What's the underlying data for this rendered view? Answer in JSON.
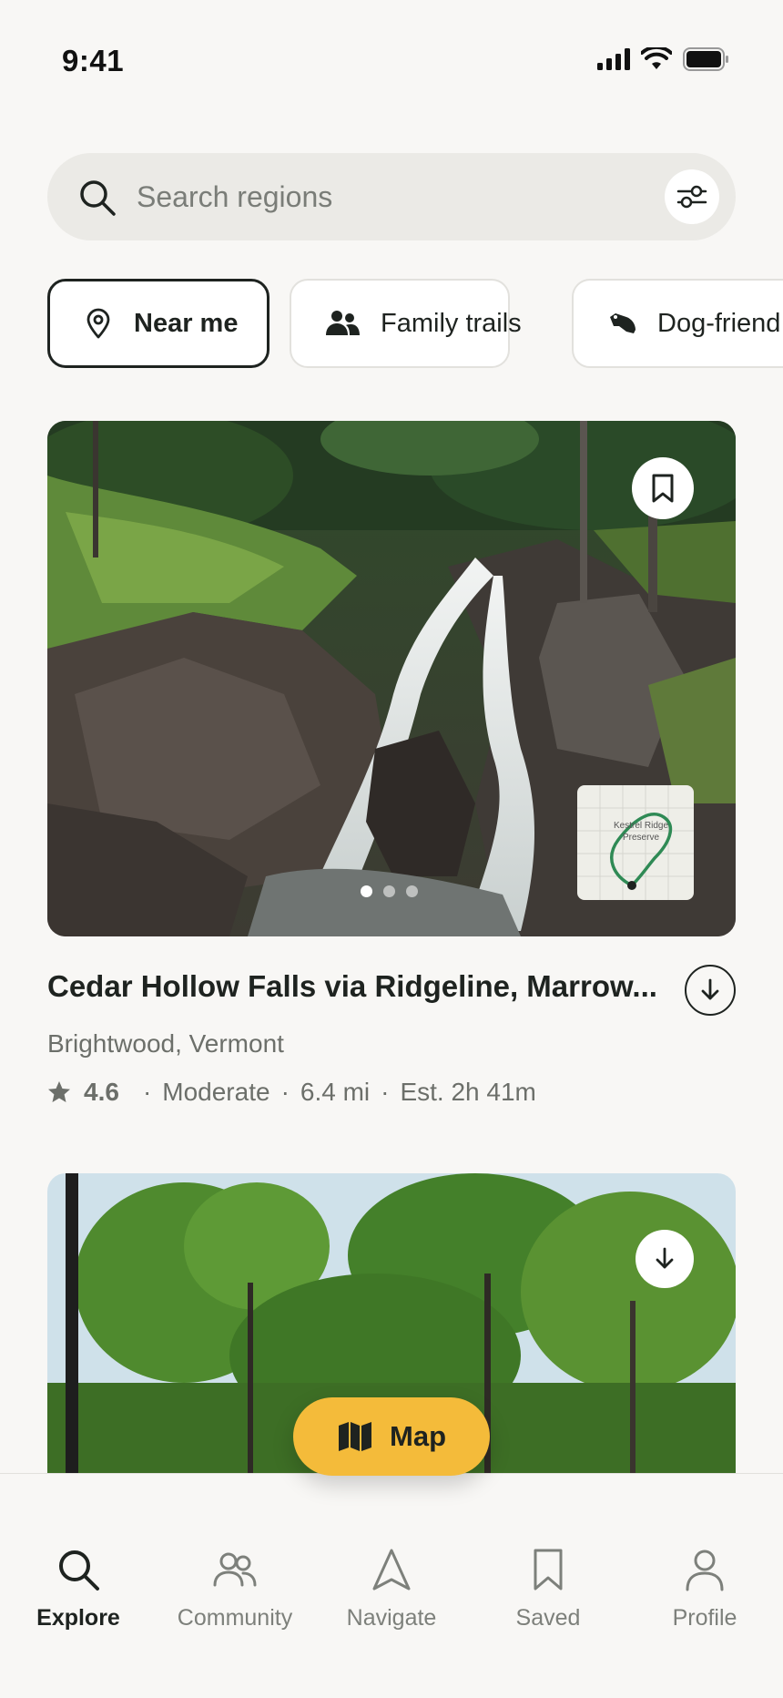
{
  "status_bar": {
    "time": "9:41"
  },
  "search": {
    "placeholder": "Search regions"
  },
  "chips": [
    {
      "label": "Near me",
      "icon": "location-pin-icon",
      "active": true
    },
    {
      "label": "Family trails",
      "icon": "people-icon",
      "active": false
    },
    {
      "label": "Dog-friend",
      "icon": "dog-icon",
      "active": false
    }
  ],
  "trail_card": {
    "title": "Cedar Hollow Falls via Ridgeline, Marrow...",
    "location": "Brightwood, Vermont",
    "rating": "4.6",
    "difficulty": "Moderate",
    "distance": "6.4 mi",
    "est_time": "Est. 2h 41m",
    "map_label": "Kestrel Ridge Preserve",
    "image_count": 3,
    "active_image": 1
  },
  "map_button": {
    "label": "Map"
  },
  "nav": {
    "items": [
      {
        "label": "Explore",
        "icon": "search-icon",
        "active": true
      },
      {
        "label": "Community",
        "icon": "community-icon",
        "active": false
      },
      {
        "label": "Navigate",
        "icon": "navigate-icon",
        "active": false
      },
      {
        "label": "Saved",
        "icon": "bookmark-icon",
        "active": false
      },
      {
        "label": "Profile",
        "icon": "profile-icon",
        "active": false
      }
    ]
  },
  "colors": {
    "accent": "#f4bb3a",
    "text": "#1e2320",
    "muted": "#6c6f6a",
    "background": "#f8f7f5"
  }
}
